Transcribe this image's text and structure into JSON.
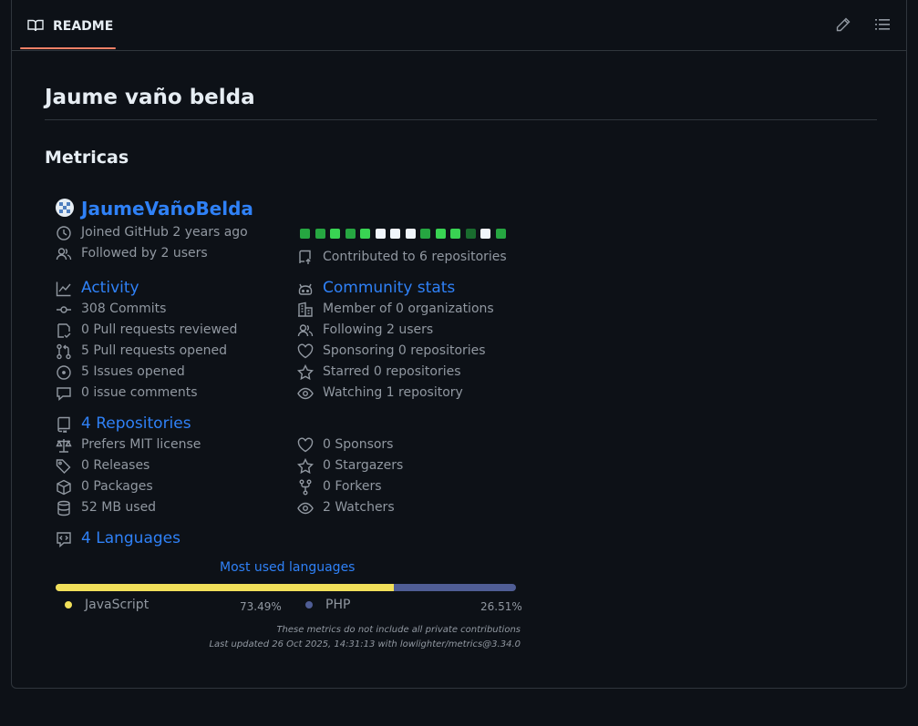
{
  "tab": {
    "label": "README"
  },
  "title": "Jaume vaño belda",
  "section": "Metricas",
  "profile": {
    "username": "JaumeVañoBelda",
    "joined": "Joined GitHub 2 years ago",
    "followed": "Followed by 2 users",
    "contributed": "Contributed to 6 repositories",
    "calendar_colors": [
      "#26a641",
      "#26a641",
      "#39d353",
      "#26a641",
      "#39d353",
      "#f0f6fc",
      "#f0f6fc",
      "#f0f6fc",
      "#26a641",
      "#39d353",
      "#39d353",
      "#196c2e",
      "#f0f6fc",
      "#26a641"
    ]
  },
  "activity": {
    "title": "Activity",
    "items": [
      "308 Commits",
      "0 Pull requests reviewed",
      "5 Pull requests opened",
      "5 Issues opened",
      "0 issue comments"
    ]
  },
  "community": {
    "title": "Community stats",
    "items": [
      "Member of 0 organizations",
      "Following 2 users",
      "Sponsoring 0 repositories",
      "Starred 0 repositories",
      "Watching 1 repository"
    ]
  },
  "repositories": {
    "title": "4 Repositories",
    "left": [
      "Prefers MIT license",
      "0 Releases",
      "0 Packages",
      "52 MB used"
    ],
    "right": [
      "0 Sponsors",
      "0 Stargazers",
      "0 Forkers",
      "2 Watchers"
    ]
  },
  "languages": {
    "title": "4 Languages",
    "subtitle": "Most used languages",
    "items": [
      {
        "name": "JavaScript",
        "percent": "73.49%",
        "value": 73.49,
        "color": "#f1e05a"
      },
      {
        "name": "PHP",
        "percent": "26.51%",
        "value": 26.51,
        "color": "#4f5d95"
      }
    ]
  },
  "footer": {
    "line1": "These metrics do not include all private contributions",
    "line2": "Last updated 26 Oct 2025, 14:31:13 with lowlighter/metrics@3.34.0"
  }
}
